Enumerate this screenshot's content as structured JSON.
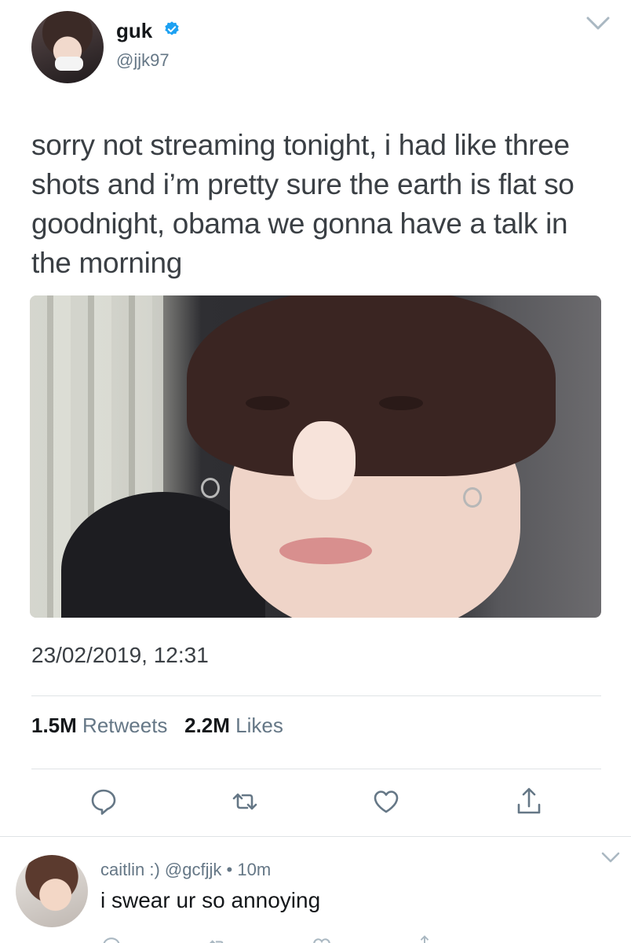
{
  "tweet": {
    "display_name": "guk",
    "handle": "@jjk97",
    "text": "sorry not streaming tonight, i had like three shots and i’m pretty sure the earth is flat so goodnight, obama we gonna have a talk in the morning",
    "timestamp": "23/02/2019, 12:31",
    "retweets_count": "1.5M",
    "retweets_label": "Retweets",
    "likes_count": "2.2M",
    "likes_label": "Likes",
    "icons": [
      "verified-badge",
      "chevron-down",
      "reply",
      "retweet",
      "like",
      "share"
    ],
    "accent_color": "#1da1f2"
  },
  "reply": {
    "display_name": "caitlin :)",
    "handle": "@gcfjjk",
    "time": "10m",
    "separator": "•",
    "text": "i swear ur so annoying"
  }
}
